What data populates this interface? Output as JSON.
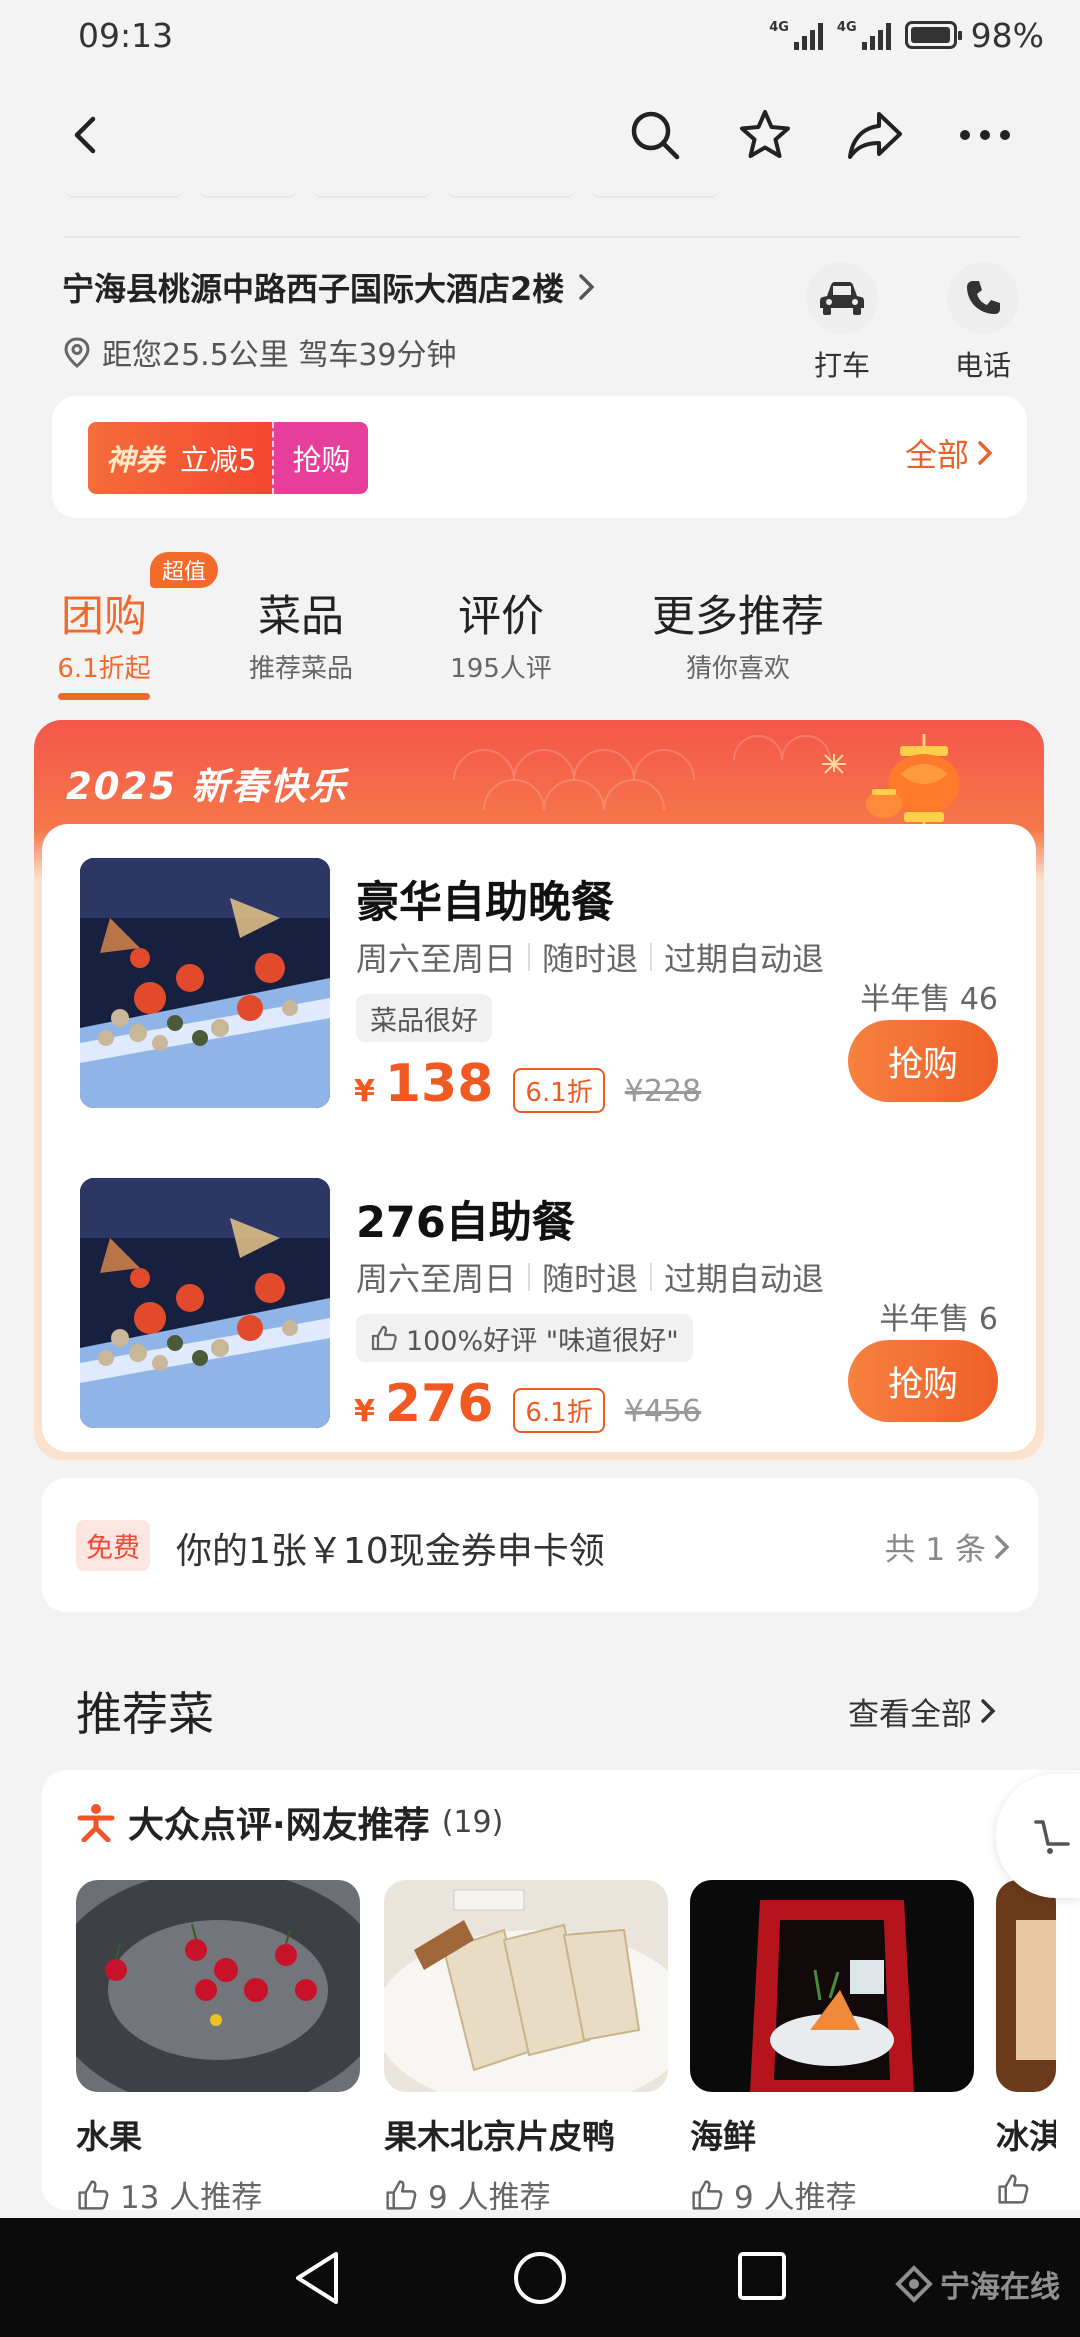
{
  "status_bar": {
    "time": "09:13",
    "signal1_tag": "4G",
    "signal2_tag": "4G",
    "battery_level": 0.98,
    "battery_text": "98%"
  },
  "nav": {
    "back_icon": "chevron-left-icon",
    "search_icon": "search-icon",
    "favorite_icon": "star-icon",
    "share_icon": "share-icon",
    "more_icon": "more-icon"
  },
  "address": {
    "line": "宁海县桃源中路西子国际大酒店2楼",
    "distance": "距您25.5公里 驾车39分钟"
  },
  "quick_actions": [
    {
      "label": "打车",
      "icon": "car-icon"
    },
    {
      "label": "电话",
      "icon": "phone-icon"
    }
  ],
  "coupon": {
    "brand": "神券",
    "amount": "立减5",
    "action": "抢购",
    "all_label": "全部"
  },
  "tabs": [
    {
      "title": "团购",
      "sub": "6.1折起",
      "badge": "超值",
      "active": true
    },
    {
      "title": "菜品",
      "sub": "推荐菜品",
      "active": false
    },
    {
      "title": "评价",
      "sub": "195人评",
      "active": false
    },
    {
      "title": "更多推荐",
      "sub": "猜你喜欢",
      "active": false
    }
  ],
  "promo": {
    "banner_title": "2025 新春快乐",
    "deals": [
      {
        "name": "豪华自助晚餐",
        "meta": [
          "周六至周日",
          "随时退",
          "过期自动退"
        ],
        "chip": "菜品很好",
        "sold": "半年售 46",
        "currency": "¥",
        "price": "138",
        "discount": "6.1折",
        "original": "¥228",
        "buy_label": "抢购"
      },
      {
        "name": "276自助餐",
        "meta": [
          "周六至周日",
          "随时退",
          "过期自动退"
        ],
        "chip": "100%好评 \"味道很好\"",
        "sold": "半年售 6",
        "currency": "¥",
        "price": "276",
        "discount": "6.1折",
        "original": "¥456",
        "buy_label": "抢购"
      }
    ]
  },
  "cash_coupon": {
    "tag": "免费",
    "text": "你的1张￥10现金券申卡领",
    "count": "共 1 条"
  },
  "recommend": {
    "title": "推荐菜",
    "more": "查看全部",
    "card_title": "大众点评·网友推荐",
    "card_count": "(19)",
    "dishes": [
      {
        "name": "水果",
        "likes": "13 人推荐"
      },
      {
        "name": "果木北京片皮鸭",
        "likes": "9 人推荐"
      },
      {
        "name": "海鲜",
        "likes": "9 人推荐"
      },
      {
        "name": "冰淇",
        "likes": ""
      }
    ]
  },
  "watermark": "宁海在线",
  "colors": {
    "accent": "#f06a2e",
    "price": "#f05a22",
    "coupon_pink": "#e83e9b"
  }
}
